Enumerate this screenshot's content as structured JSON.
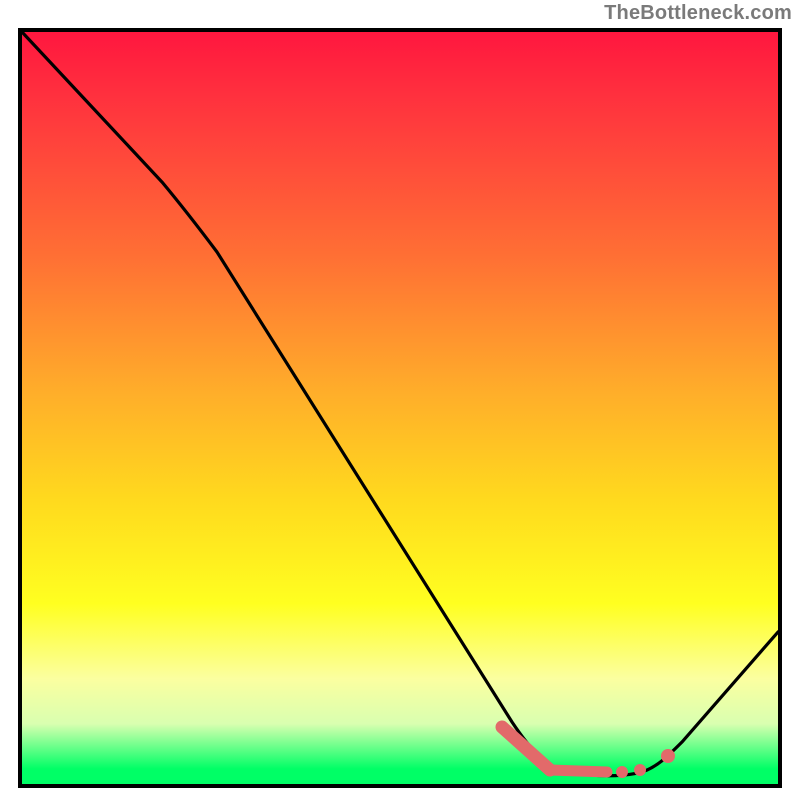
{
  "watermark": "TheBottleneck.com",
  "chart_data": {
    "type": "line",
    "title": "",
    "xlabel": "",
    "ylabel": "",
    "xlim": [
      0,
      100
    ],
    "ylim": [
      0,
      100
    ],
    "series": [
      {
        "name": "curve",
        "x": [
          0,
          18,
          24,
          65,
          70,
          75,
          80,
          85,
          100
        ],
        "values": [
          100,
          80,
          77,
          8,
          3,
          1,
          1,
          3,
          20
        ]
      }
    ],
    "markers": [
      {
        "name": "dash-segment",
        "shape": "line-thick",
        "x0": 63,
        "y0": 7,
        "x1": 69,
        "y1": 2,
        "color": "#e26a6a"
      },
      {
        "name": "dash-flat",
        "shape": "line-thick",
        "x0": 69,
        "y0": 2,
        "x1": 76,
        "y1": 2,
        "color": "#e26a6a"
      },
      {
        "name": "dot-1",
        "shape": "dot",
        "x": 78,
        "y": 2,
        "color": "#e26a6a"
      },
      {
        "name": "dot-2",
        "shape": "dot",
        "x": 80,
        "y": 2,
        "color": "#e26a6a"
      },
      {
        "name": "dot-3",
        "shape": "dot",
        "x": 84,
        "y": 4,
        "color": "#e26a6a"
      }
    ],
    "colors": {
      "gradient_top": "#ff173f",
      "gradient_mid": "#ffff20",
      "gradient_bottom": "#00ff66",
      "frame": "#000000",
      "marker": "#e26a6a"
    }
  }
}
